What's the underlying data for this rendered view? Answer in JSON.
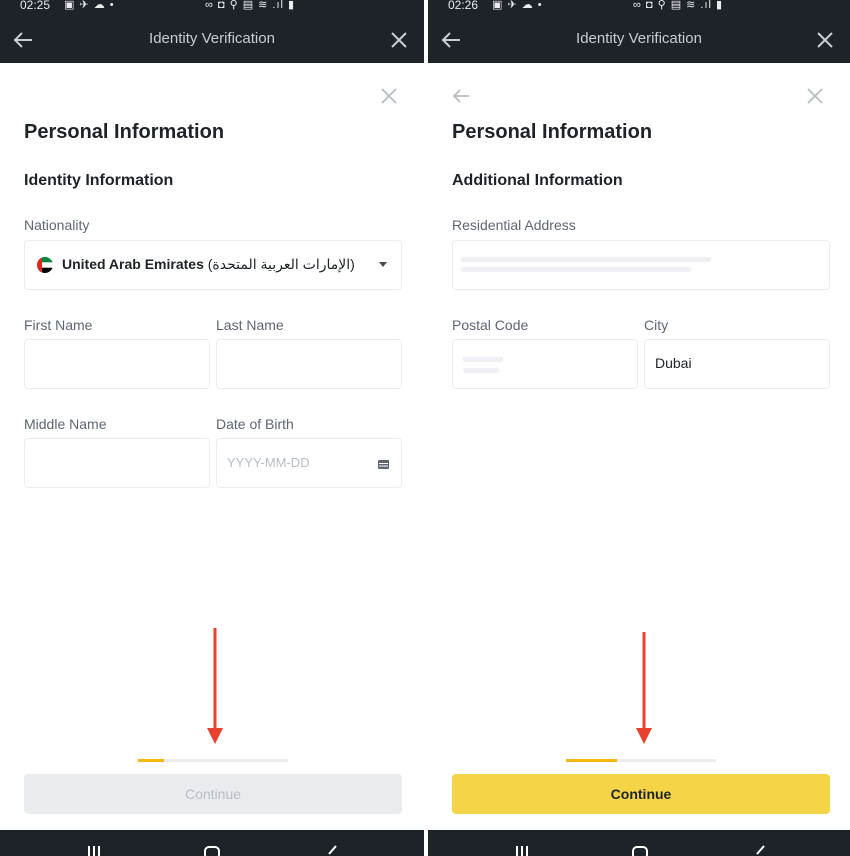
{
  "colors": {
    "dark_bar": "#1e2329",
    "accent_yellow": "#f5d547",
    "progress_yellow": "#f0b90b",
    "arrow_red": "#e8412e",
    "disabled_btn": "#e9ebee"
  },
  "left": {
    "status": {
      "time": "02:25",
      "icons_left": "▣ ✈ ☁ •",
      "icons_right": "∞ ◘ ⚲ ▤ ≋ .ıl ▮"
    },
    "app_bar": {
      "title": "Identity Verification",
      "back_icon": "arrow-left-icon",
      "close_icon": "close-icon"
    },
    "heading": "Personal Information",
    "section": "Identity Information",
    "nationality": {
      "label": "Nationality",
      "value": "United Arab Emirates",
      "value_native": "(الإمارات العربية المتحدة)",
      "flag_icon": "uae-flag-icon"
    },
    "first_name": {
      "label": "First Name",
      "value": ""
    },
    "last_name": {
      "label": "Last Name",
      "value": ""
    },
    "middle_name": {
      "label": "Middle Name",
      "value": ""
    },
    "dob": {
      "label": "Date of Birth",
      "placeholder": "YYYY-MM-DD",
      "icon": "calendar-icon"
    },
    "progress": 0.17,
    "continue_label": "Continue",
    "continue_enabled": false
  },
  "right": {
    "status": {
      "time": "02:26",
      "icons_left": "▣ ✈ ☁ •",
      "icons_right": "∞ ◘ ⚲ ▤ ≋ .ıl ▮"
    },
    "app_bar": {
      "title": "Identity Verification",
      "back_icon": "arrow-left-icon",
      "close_icon": "close-icon"
    },
    "heading": "Personal Information",
    "section": "Additional Information",
    "residential_address": {
      "label": "Residential Address",
      "value": ""
    },
    "postal_code": {
      "label": "Postal Code",
      "value": ""
    },
    "city": {
      "label": "City",
      "value": "Dubai"
    },
    "progress": 0.34,
    "continue_label": "Continue",
    "continue_enabled": true
  },
  "nav_bar": {
    "icons": [
      "recent-apps-icon",
      "home-icon",
      "back-icon"
    ]
  }
}
